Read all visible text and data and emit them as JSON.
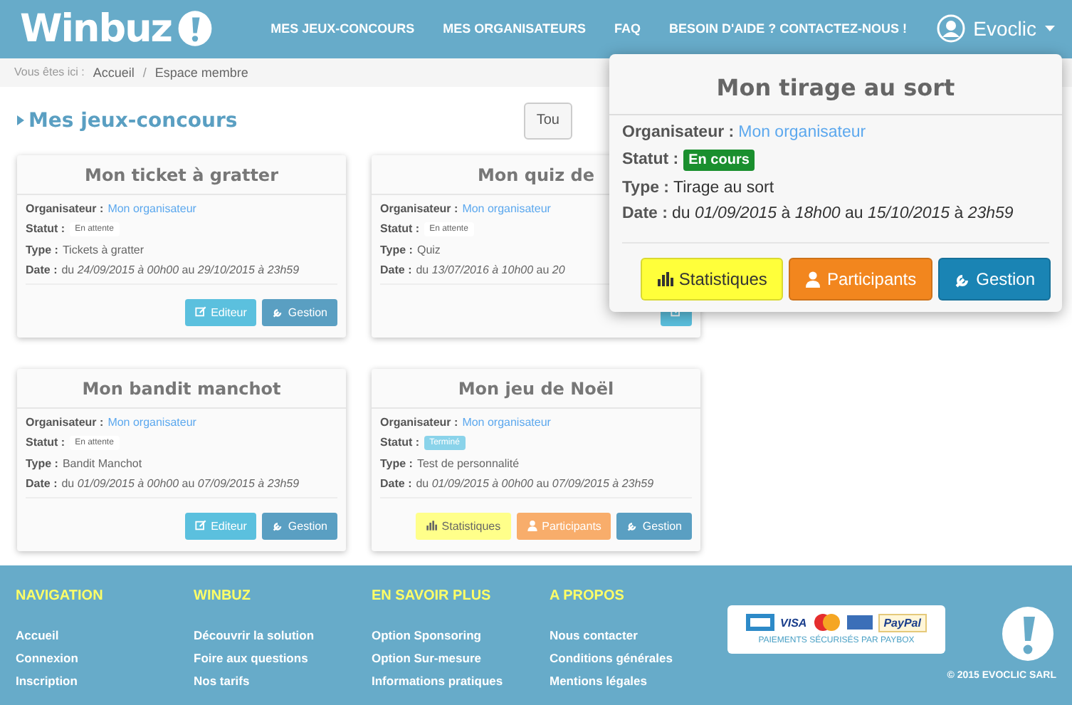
{
  "header": {
    "logo": "Winbuz",
    "nav": [
      "MES JEUX-CONCOURS",
      "MES ORGANISATEURS",
      "FAQ",
      "BESOIN D'AIDE ? CONTACTEZ-NOUS !"
    ],
    "user": "Evoclic"
  },
  "breadcrumb": {
    "prefix": "Vous êtes ici :",
    "separator": "/",
    "items": [
      "Accueil",
      "Espace membre"
    ]
  },
  "page_title": "Mes jeux-concours",
  "filter": {
    "value": "Tou"
  },
  "cards": [
    {
      "title": "Mon ticket à gratter",
      "organiser_label": "Organisateur :",
      "organiser": "Mon organisateur",
      "status_label": "Statut :",
      "status": {
        "text": "En attente",
        "kind": "pending"
      },
      "type_label": "Type :",
      "type": "Tickets à gratter",
      "date_label": "Date :",
      "date": "du *24/09/2015 à 00h00* au *29/10/2015 à 23h59*",
      "buttons": [
        {
          "kind": "editor",
          "label": "Editeur"
        },
        {
          "kind": "manage",
          "label": "Gestion"
        }
      ]
    },
    {
      "title": "Mon quiz de",
      "organiser_label": "Organisateur :",
      "organiser": "Mon organisateur",
      "status_label": "Statut :",
      "status": {
        "text": "En attente",
        "kind": "pending"
      },
      "type_label": "Type :",
      "type": "Quiz",
      "date_label": "Date :",
      "date": "du *13/07/2016 à 10h00* au *20*",
      "buttons": [
        {
          "kind": "editor"
        }
      ]
    },
    {
      "title": "Mon bandit manchot",
      "organiser_label": "Organisateur :",
      "organiser": "Mon organisateur",
      "status_label": "Statut :",
      "status": {
        "text": "En attente",
        "kind": "pending"
      },
      "type_label": "Type :",
      "type": "Bandit Manchot",
      "date_label": "Date :",
      "date": "du *01/09/2015 à 00h00* au *07/09/2015 à 23h59*",
      "buttons": [
        {
          "kind": "editor",
          "label": "Editeur"
        },
        {
          "kind": "manage",
          "label": "Gestion"
        }
      ]
    },
    {
      "title": "Mon jeu de Noël",
      "organiser_label": "Organisateur :",
      "organiser": "Mon organisateur",
      "status_label": "Statut :",
      "status": {
        "text": "Terminé",
        "kind": "done"
      },
      "type_label": "Type :",
      "type": "Test de personnalité",
      "date_label": "Date :",
      "date": "du *01/09/2015 à 00h00* au *07/09/2015 à 23h59*",
      "buttons": [
        {
          "kind": "stats",
          "label": "Statistiques"
        },
        {
          "kind": "participants",
          "label": "Participants"
        },
        {
          "kind": "manage",
          "label": "Gestion"
        }
      ]
    }
  ],
  "popup": {
    "title": "Mon tirage au sort",
    "organiser_label": "Organisateur :",
    "organiser": "Mon organisateur",
    "status_label": "Statut :",
    "status": {
      "text": "En cours",
      "kind": "active"
    },
    "type_label": "Type :",
    "type": "Tirage au sort",
    "date_label": "Date :",
    "date": "du *01/09/2015* à *18h00* au *15/10/2015* à *23h59*",
    "buttons": [
      {
        "kind": "stats",
        "label": "Statistiques"
      },
      {
        "kind": "participants",
        "label": "Participants"
      },
      {
        "kind": "manage",
        "label": "Gestion"
      }
    ]
  },
  "footer": {
    "columns": [
      {
        "title": "NAVIGATION",
        "links": [
          "Accueil",
          "Connexion",
          "Inscription"
        ]
      },
      {
        "title": "WINBUZ",
        "links": [
          "Découvrir la solution",
          "Foire aux questions",
          "Nos tarifs"
        ]
      },
      {
        "title": "EN SAVOIR PLUS",
        "links": [
          "Option Sponsoring",
          "Option Sur-mesure",
          "Informations pratiques"
        ]
      },
      {
        "title": "A PROPOS",
        "links": [
          "Nous contacter",
          "Conditions générales",
          "Mentions légales"
        ]
      }
    ],
    "payment": {
      "logos": [
        "VISA",
        "PayPal"
      ],
      "caption": "PAIEMENTS SÉCURISÉS PAR PAYBOX"
    },
    "copyright": "© 2015 EVOCLIC SARL"
  }
}
